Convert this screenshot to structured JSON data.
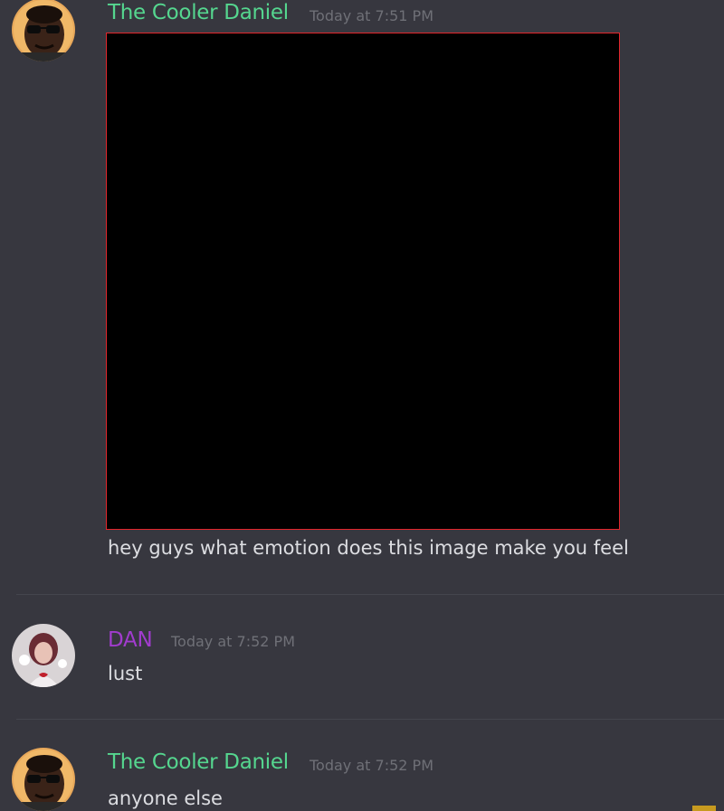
{
  "messages": [
    {
      "username": "The Cooler Daniel",
      "username_color": "#55d68f",
      "timestamp": "Today at 7:51 PM",
      "avatar_icon": "sunglasses-avatar-icon",
      "has_image": true,
      "text": "hey guys what emotion does this image make you feel"
    },
    {
      "username": "DAN",
      "username_color": "#a13cce",
      "timestamp": "Today at 7:52 PM",
      "avatar_icon": "anime-girl-avatar-icon",
      "has_image": false,
      "text": "lust"
    },
    {
      "username": "The Cooler Daniel",
      "username_color": "#55d68f",
      "timestamp": "Today at 7:52 PM",
      "avatar_icon": "sunglasses-avatar-icon",
      "has_image": false,
      "text": "anyone else"
    }
  ],
  "colors": {
    "background": "#37373f",
    "image_border": "#e3262c",
    "message_text": "#dcdde1",
    "timestamp": "#6f7077"
  }
}
